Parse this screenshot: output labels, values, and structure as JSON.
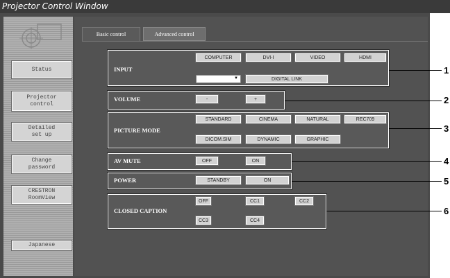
{
  "window": {
    "title": "Projector Control Window"
  },
  "sidebar": {
    "items": [
      {
        "label": "Status"
      },
      {
        "label": "Projector\ncontrol"
      },
      {
        "label": "Detailed\nset up"
      },
      {
        "label": "Change\npassword"
      },
      {
        "label": "CRESTRON\nRoomView"
      },
      {
        "label": "Japanese"
      }
    ]
  },
  "tabs": [
    {
      "label": "Basic control",
      "active": true
    },
    {
      "label": "Advanced control",
      "active": false
    }
  ],
  "groups": {
    "input": {
      "label": "INPUT",
      "buttons": [
        "COMPUTER",
        "DVI-I",
        "VIDEO",
        "HDMI"
      ],
      "select_value": "",
      "digital_link": "DIGITAL LINK"
    },
    "volume": {
      "label": "VOLUME",
      "buttons": [
        "-",
        "+"
      ]
    },
    "picture_mode": {
      "label": "PICTURE MODE",
      "buttons": [
        "STANDARD",
        "CINEMA",
        "NATURAL",
        "REC709",
        "DICOM.SIM",
        "DYNAMIC",
        "GRAPHIC"
      ]
    },
    "av_mute": {
      "label": "AV MUTE",
      "buttons": [
        "OFF",
        "ON"
      ]
    },
    "power": {
      "label": "POWER",
      "buttons": [
        "STANDBY",
        "ON"
      ]
    },
    "closed_caption": {
      "label": "CLOSED CAPTION",
      "buttons": [
        "OFF",
        "CC1",
        "CC2",
        "CC3",
        "CC4"
      ]
    }
  },
  "callouts": [
    "1",
    "2",
    "3",
    "4",
    "5",
    "6"
  ],
  "colors": {
    "title_bar": "#3a3a3a",
    "panel": "#525252",
    "button": "#d2d2d2"
  }
}
